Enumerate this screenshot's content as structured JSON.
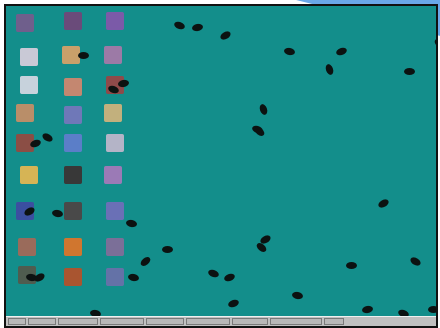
{
  "colors": {
    "desktop": "#138e8b",
    "taskbar": "#c0c0c0",
    "bug": "#0c1211"
  },
  "desktop_icons": [
    {
      "icon": "computer-icon",
      "color": "#6f5f8c"
    },
    {
      "icon": "folder-icon",
      "color": "#6a4b7a"
    },
    {
      "icon": "app-icon",
      "color": "#7b5aa8"
    },
    {
      "icon": "user-icon",
      "color": "#c9c9d6"
    },
    {
      "icon": "network-icon",
      "color": "#c9a06a"
    },
    {
      "icon": "drive-icon",
      "color": "#9c7aa6"
    },
    {
      "icon": "folder-icon",
      "color": "#c7d2dc"
    },
    {
      "icon": "box-icon",
      "color": "#c48770"
    },
    {
      "icon": "app-icon",
      "color": "#8e4a4a"
    },
    {
      "icon": "document-icon",
      "color": "#b98e69"
    },
    {
      "icon": "globe-icon",
      "color": "#6f78b8"
    },
    {
      "icon": "app-icon",
      "color": "#c2b07d"
    },
    {
      "icon": "app-icon",
      "color": "#8b4e45"
    },
    {
      "icon": "globe-icon",
      "color": "#5b7ec8"
    },
    {
      "icon": "app-icon",
      "color": "#b4b4c7"
    },
    {
      "icon": "star-icon",
      "color": "#d6b455"
    },
    {
      "icon": "app-icon",
      "color": "#383838"
    },
    {
      "icon": "app-icon",
      "color": "#9b7ab6"
    },
    {
      "icon": "app-icon",
      "color": "#3b4fa0"
    },
    {
      "icon": "app-icon",
      "color": "#494949"
    },
    {
      "icon": "app-icon",
      "color": "#6a70b6"
    },
    {
      "icon": "app-icon",
      "color": "#9a6b5b"
    },
    {
      "icon": "app-icon",
      "color": "#d0762f"
    },
    {
      "icon": "app-icon",
      "color": "#7b6f98"
    },
    {
      "icon": "app-icon",
      "color": "#4f5c4f"
    },
    {
      "icon": "app-icon",
      "color": "#a95530"
    },
    {
      "icon": "app-icon",
      "color": "#6472a7"
    }
  ],
  "taskbar": {
    "buttons": [
      "",
      "",
      "",
      "",
      "",
      "",
      "",
      ""
    ]
  }
}
